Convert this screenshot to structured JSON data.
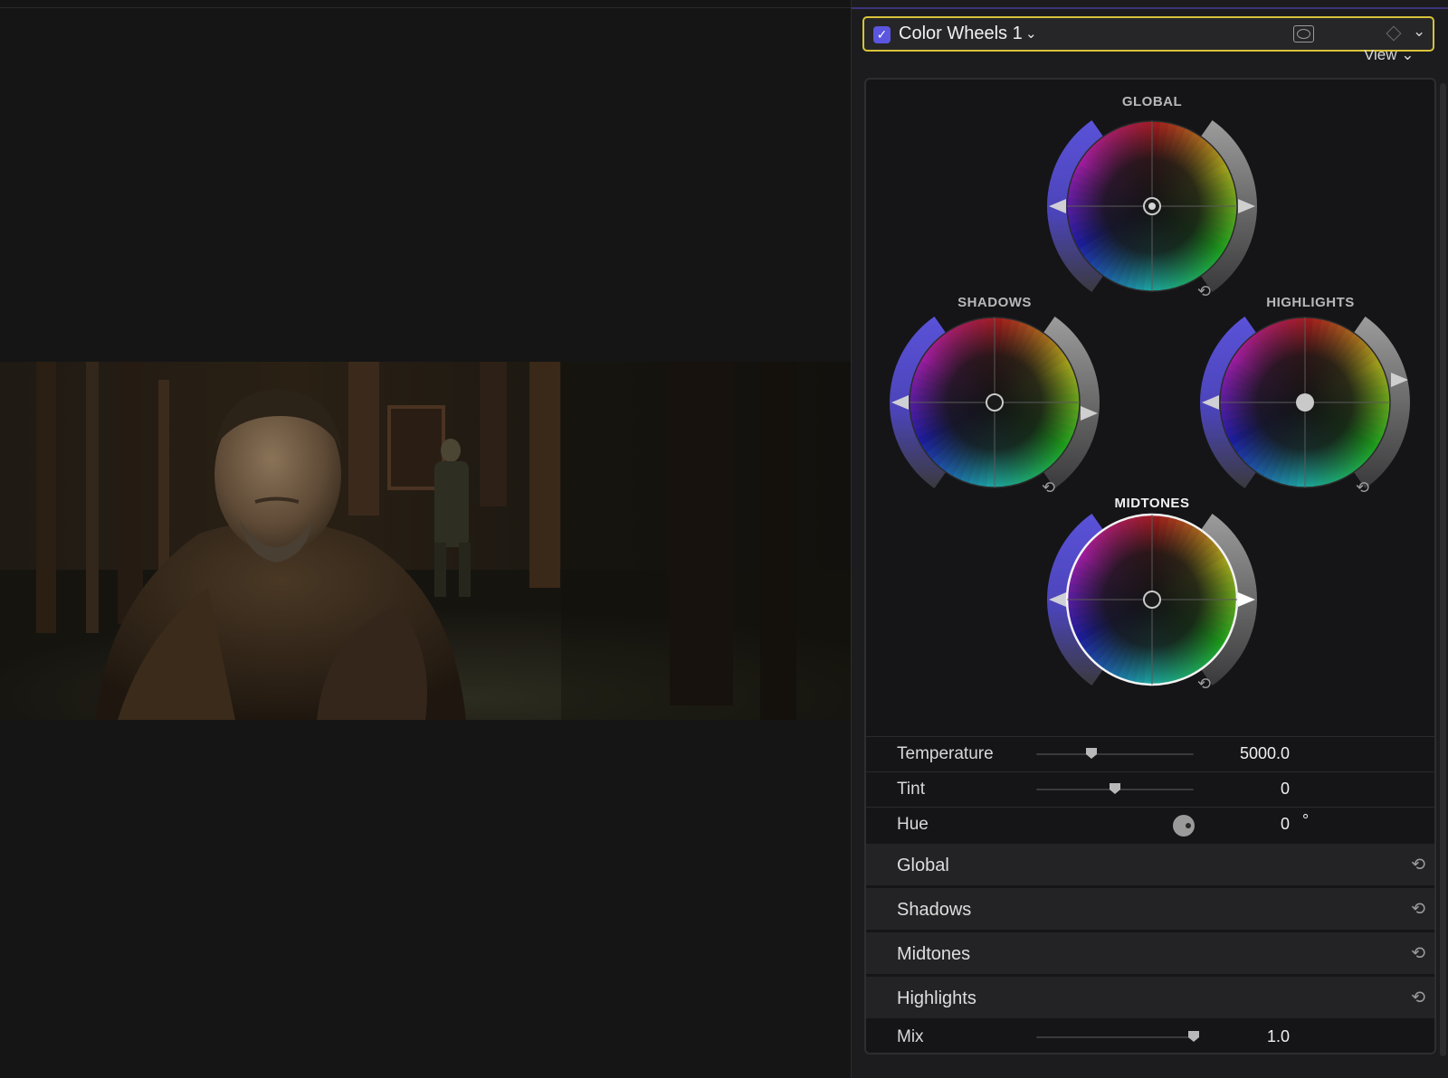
{
  "effect": {
    "enabled": true,
    "name": "Color Wheels 1",
    "chevron": "⌄",
    "icons": [
      "mask-icon",
      "keyframe-diamond-icon",
      "collapse-chevron-icon"
    ]
  },
  "view_menu": "View ⌄",
  "wheels": [
    {
      "id": "global",
      "label": "GLOBAL",
      "puck": "target",
      "active": false
    },
    {
      "id": "shadows",
      "label": "SHADOWS",
      "puck": "ring",
      "active": false
    },
    {
      "id": "highlights",
      "label": "HIGHLIGHTS",
      "puck": "dot",
      "active": false
    },
    {
      "id": "midtones",
      "label": "MIDTONES",
      "puck": "ring",
      "active": true
    }
  ],
  "params": {
    "temperature": {
      "label": "Temperature",
      "value": "5000.0",
      "position": 0.35
    },
    "tint": {
      "label": "Tint",
      "value": "0",
      "position": 0.5
    },
    "hue": {
      "label": "Hue",
      "value": "0",
      "unit": "°"
    },
    "mix": {
      "label": "Mix",
      "value": "1.0",
      "position": 1.0
    }
  },
  "sections": [
    "Global",
    "Shadows",
    "Midtones",
    "Highlights"
  ],
  "reset_glyph": "⟲",
  "colors": {
    "accent": "#5b55e0",
    "selection_border": "#d8c23a",
    "saturation_handle": "#5a52d8"
  }
}
